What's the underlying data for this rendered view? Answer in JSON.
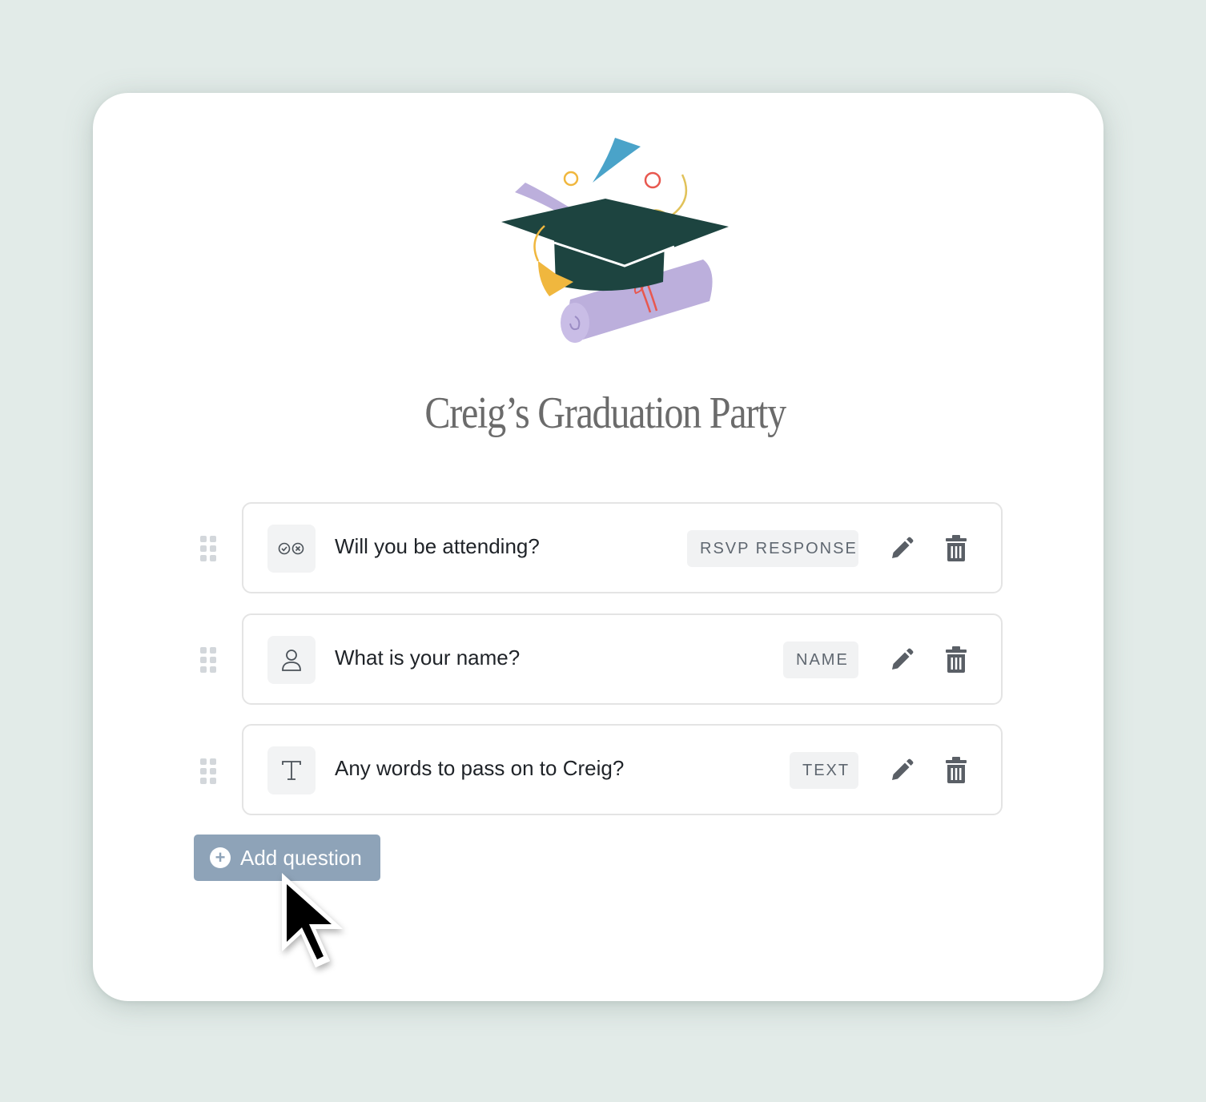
{
  "event": {
    "title": "Creig’s Graduation Party"
  },
  "questions": [
    {
      "text": "Will you be attending?",
      "tag": "RSVP RESPONSE",
      "icon": "rsvp-check-cross-icon"
    },
    {
      "text": "What is your name?",
      "tag": "NAME",
      "icon": "person-icon"
    },
    {
      "text": "Any words to pass on to Creig?",
      "tag": "TEXT",
      "icon": "text-t-icon"
    }
  ],
  "actions": {
    "add_question_label": "Add question",
    "edit_icon": "pencil-icon",
    "delete_icon": "trash-icon",
    "drag_icon": "drag-handle-icon"
  },
  "colors": {
    "background": "#e2ebe8",
    "card": "#ffffff",
    "button": "#8ea3b8",
    "cap": "#1d4440",
    "diploma": "#bcafdc",
    "tassel": "#f0b73e",
    "confetti_blue": "#4aa3c9",
    "confetti_red": "#e8584f"
  }
}
